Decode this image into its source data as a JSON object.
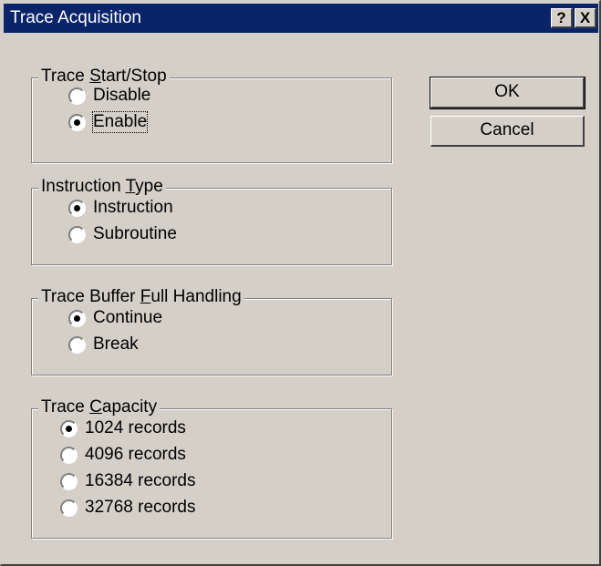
{
  "title": "Trace Acquisition",
  "titlebar": {
    "help": "?",
    "close": "X"
  },
  "groups": {
    "start_stop": {
      "legend_pre": "Trace ",
      "legend_key": "S",
      "legend_post": "tart/Stop",
      "options": [
        {
          "label": "Disable",
          "checked": false
        },
        {
          "label": "Enable",
          "checked": true
        }
      ]
    },
    "instruction_type": {
      "legend_pre": "Instruction ",
      "legend_key": "T",
      "legend_post": "ype",
      "options": [
        {
          "label": "Instruction",
          "checked": true
        },
        {
          "label": "Subroutine",
          "checked": false
        }
      ]
    },
    "buffer_full": {
      "legend_pre": "Trace Buffer ",
      "legend_key": "F",
      "legend_post": "ull Handling",
      "options": [
        {
          "label": "Continue",
          "checked": true
        },
        {
          "label": "Break",
          "checked": false
        }
      ]
    },
    "capacity": {
      "legend_pre": "Trace ",
      "legend_key": "C",
      "legend_post": "apacity",
      "options": [
        {
          "label": "1024 records",
          "checked": true
        },
        {
          "label": "4096 records",
          "checked": false
        },
        {
          "label": "16384 records",
          "checked": false
        },
        {
          "label": "32768 records",
          "checked": false
        }
      ]
    }
  },
  "buttons": {
    "ok": "OK",
    "cancel": "Cancel"
  }
}
